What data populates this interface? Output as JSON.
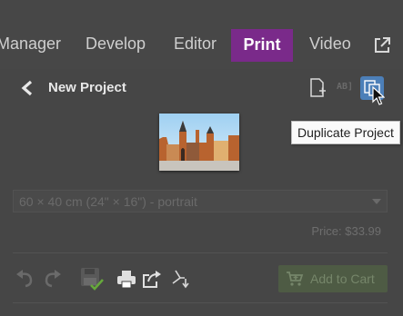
{
  "nav": {
    "items": [
      {
        "label": "Manager"
      },
      {
        "label": "Develop"
      },
      {
        "label": "Editor"
      },
      {
        "label": "Print",
        "active": true
      },
      {
        "label": "Video"
      }
    ],
    "external_icon": "external-link-icon",
    "active_color": "#7a2a8a"
  },
  "project": {
    "back_icon": "chevron-left-icon",
    "title": "New Project",
    "toolbar_icons": [
      "new-page-icon",
      "text-ab-icon",
      "duplicate-icon"
    ],
    "ab_label": "AB]",
    "tooltip": "Duplicate Project",
    "accent_color": "#4c7fb8"
  },
  "print": {
    "size_value": "60 × 40 cm (24\" × 16\") - portrait",
    "price": "Price: $33.99"
  },
  "toolbar": {
    "icons": [
      "undo-icon",
      "redo-icon",
      "save-icon",
      "print-icon",
      "share-icon",
      "export-icon"
    ],
    "add_to_cart_label": "Add to Cart",
    "cart_color": "#4e5b44"
  }
}
